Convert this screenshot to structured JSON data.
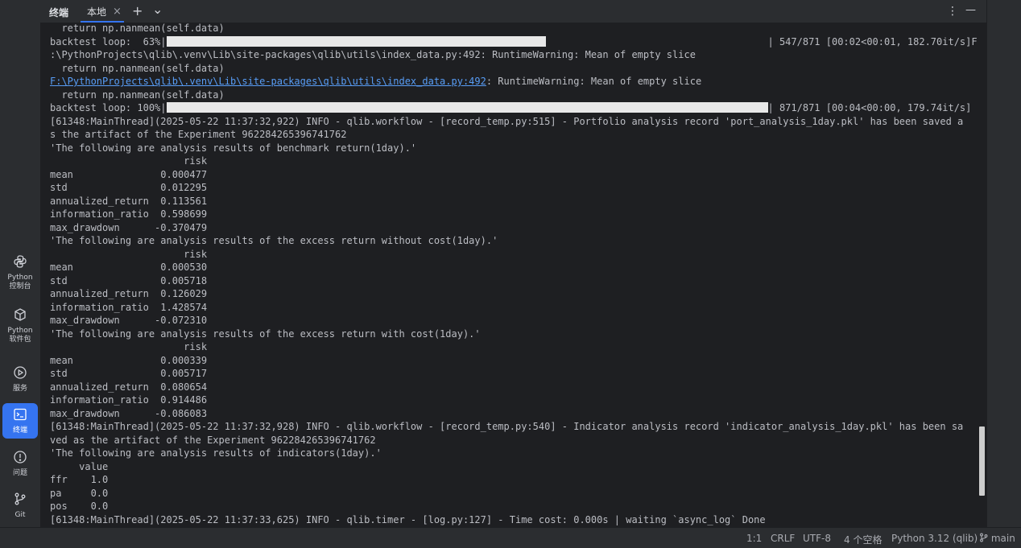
{
  "header": {
    "title": "终端",
    "tab_label": "本地",
    "close_glyph": "×",
    "add_glyph": "+",
    "menu_glyph": "⌄",
    "more_glyph": "⋮",
    "minimize_glyph": "—"
  },
  "sidebar": {
    "items": [
      {
        "label": "Python\n控制台",
        "icon": "python-icon"
      },
      {
        "label": "Python\n软件包",
        "icon": "packages-icon"
      },
      {
        "label": "服务",
        "icon": "services-icon"
      },
      {
        "label": "终端",
        "icon": "terminal-icon",
        "active": true
      },
      {
        "label": "问题",
        "icon": "problems-icon"
      },
      {
        "label": "Git",
        "icon": "git-icon"
      }
    ]
  },
  "terminal": {
    "lines": [
      "  return np.nanmean(self.data)",
      "backtest loop:  63%|",
      ":\\PythonProjects\\qlib\\.venv\\Lib\\site-packages\\qlib\\utils\\index_data.py:492: RuntimeWarning: Mean of empty slice",
      "  return np.nanmean(self.data)",
      "F:\\PythonProjects\\qlib\\.venv\\Lib\\site-packages\\qlib\\utils\\index_data.py:492: RuntimeWarning: Mean of empty slice",
      "  return np.nanmean(self.data)",
      "backtest loop: 100%|",
      "[61348:MainThread](2025-05-22 11:37:32,922) INFO - qlib.workflow - [record_temp.py:515] - Portfolio analysis record 'port_analysis_1day.pkl' has been saved a",
      "s the artifact of the Experiment 962284265396741762",
      "'The following are analysis results of benchmark return(1day).'",
      "                       risk",
      "mean               0.000477",
      "std                0.012295",
      "annualized_return  0.113561",
      "information_ratio  0.598699",
      "max_drawdown      -0.370479",
      "'The following are analysis results of the excess return without cost(1day).'",
      "                       risk",
      "mean               0.000530",
      "std                0.005718",
      "annualized_return  0.126029",
      "information_ratio  1.428574",
      "max_drawdown      -0.072310",
      "'The following are analysis results of the excess return with cost(1day).'",
      "                       risk",
      "mean               0.000339",
      "std                0.005717",
      "annualized_return  0.080654",
      "information_ratio  0.914486",
      "max_drawdown      -0.086083",
      "[61348:MainThread](2025-05-22 11:37:32,928) INFO - qlib.workflow - [record_temp.py:540] - Indicator analysis record 'indicator_analysis_1day.pkl' has been sa",
      "ved as the artifact of the Experiment 962284265396741762",
      "'The following are analysis results of indicators(1day).'",
      "     value",
      "ffr    1.0",
      "pa     0.0",
      "pos    0.0",
      "[61348:MainThread](2025-05-22 11:37:33,625) INFO - qlib.timer - [log.py:127] - Time cost: 0.000s | waiting `async_log` Done"
    ],
    "link_line_index": 4,
    "link_text": "F:\\PythonProjects\\qlib\\.venv\\Lib\\site-packages\\qlib\\utils\\index_data.py:492",
    "progress": [
      {
        "line_index": 1,
        "fraction": 0.63,
        "suffix": "| 547/871 [00:02<00:01, 182.70it/s]F"
      },
      {
        "line_index": 6,
        "fraction": 1.0,
        "suffix": "| 871/871 [00:04<00:00, 179.74it/s]"
      }
    ]
  },
  "statusbar": {
    "position": "1:1",
    "line_ending": "CRLF",
    "encoding": "UTF-8",
    "indent": "4 个空格",
    "interpreter": "Python 3.12 (qlib)",
    "branch": "main"
  }
}
